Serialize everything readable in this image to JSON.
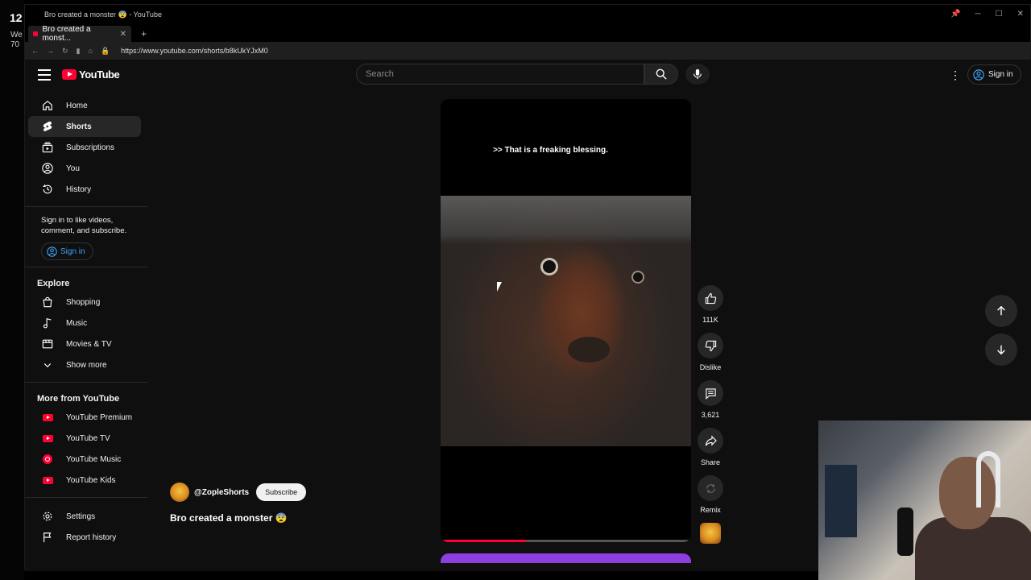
{
  "desktop": {
    "clock": "12",
    "line1": "We",
    "line2": "70"
  },
  "window": {
    "title": "Bro created a monster 😨 - YouTube",
    "tab_title": "Bro created a monst...",
    "url": "https://www.youtube.com/shorts/b8kUkYJxM0"
  },
  "masthead": {
    "logo": "YouTube",
    "search_placeholder": "Search",
    "sign_in": "Sign in"
  },
  "sidebar": {
    "primary": [
      {
        "label": "Home",
        "icon": "home-icon"
      },
      {
        "label": "Shorts",
        "icon": "shorts-icon",
        "active": true
      },
      {
        "label": "Subscriptions",
        "icon": "subscriptions-icon"
      },
      {
        "label": "You",
        "icon": "you-icon"
      },
      {
        "label": "History",
        "icon": "history-icon"
      }
    ],
    "signin_message": "Sign in to like videos, comment, and subscribe.",
    "signin_button": "Sign in",
    "explore_title": "Explore",
    "explore": [
      {
        "label": "Shopping",
        "icon": "shopping-icon"
      },
      {
        "label": "Music",
        "icon": "music-icon"
      },
      {
        "label": "Movies & TV",
        "icon": "movies-icon"
      },
      {
        "label": "Show more",
        "icon": "chevron-down-icon"
      }
    ],
    "more_title": "More from YouTube",
    "more": [
      {
        "label": "YouTube Premium"
      },
      {
        "label": "YouTube TV"
      },
      {
        "label": "YouTube Music"
      },
      {
        "label": "YouTube Kids"
      }
    ],
    "settings": "Settings",
    "report_history": "Report history"
  },
  "short": {
    "caption": ">> That is a freaking blessing.",
    "progress": 0.34,
    "channel": "@ZopleShorts",
    "subscribe": "Subscribe",
    "title": "Bro created a monster 😨"
  },
  "actions": {
    "likes": "111K",
    "dislike": "Dislike",
    "comments": "3,621",
    "share": "Share",
    "remix": "Remix"
  },
  "colors": {
    "accent": "#ff0033",
    "background": "#0f0f0f",
    "link": "#3ea6ff"
  }
}
